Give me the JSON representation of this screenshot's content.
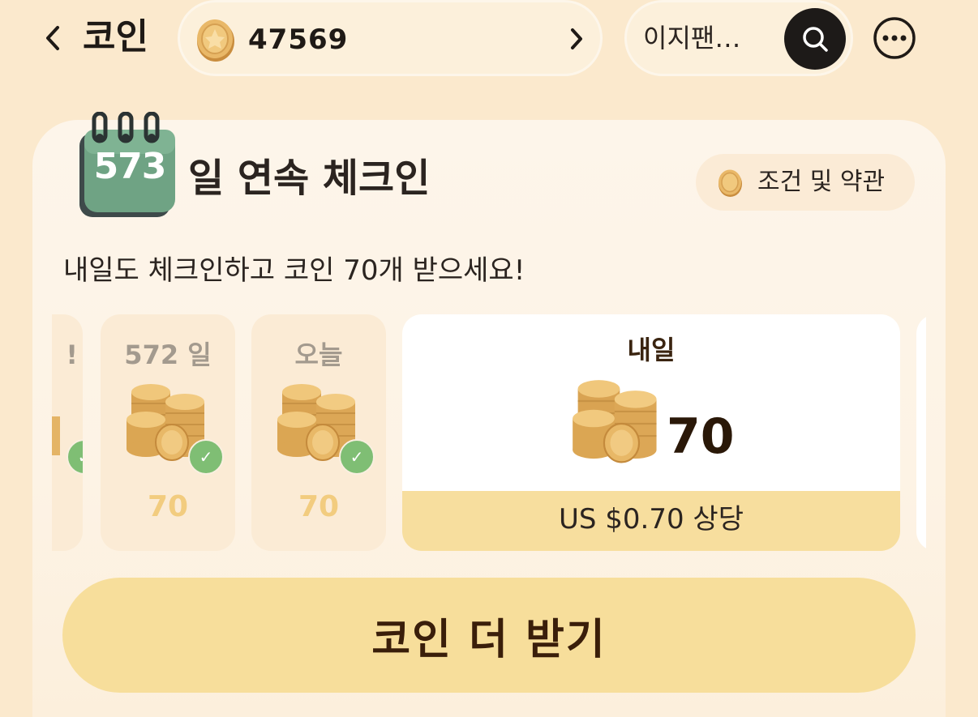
{
  "header": {
    "back_icon": "chevron-left-icon",
    "title": "코인",
    "coin_balance": "47569",
    "coin_icon": "coin-icon",
    "balance_chevron_icon": "chevron-right-icon",
    "search_text": "이지팬…",
    "search_icon": "search-icon",
    "more_icon": "more-icon"
  },
  "checkin": {
    "streak_days": "573",
    "title": "일 연속 체크인",
    "terms_label": "조건 및 약관",
    "subtitle": "내일도 체크인하고 코인 70개 받으세요!",
    "days": [
      {
        "label": "!",
        "value": "",
        "checked": true
      },
      {
        "label": "572 일",
        "value": "70",
        "checked": true
      },
      {
        "label": "오늘",
        "value": "70",
        "checked": true
      }
    ],
    "tomorrow": {
      "label": "내일",
      "value": "70",
      "usd_equivalent": "US $0.70 상당"
    },
    "cta_label": "코인 더 받기"
  },
  "colors": {
    "background": "#fbe9cd",
    "card": "#fdf5ea",
    "accent_yellow": "#f7de9e",
    "check_green": "#7fbe74",
    "coin_gold": "#e7b865"
  }
}
